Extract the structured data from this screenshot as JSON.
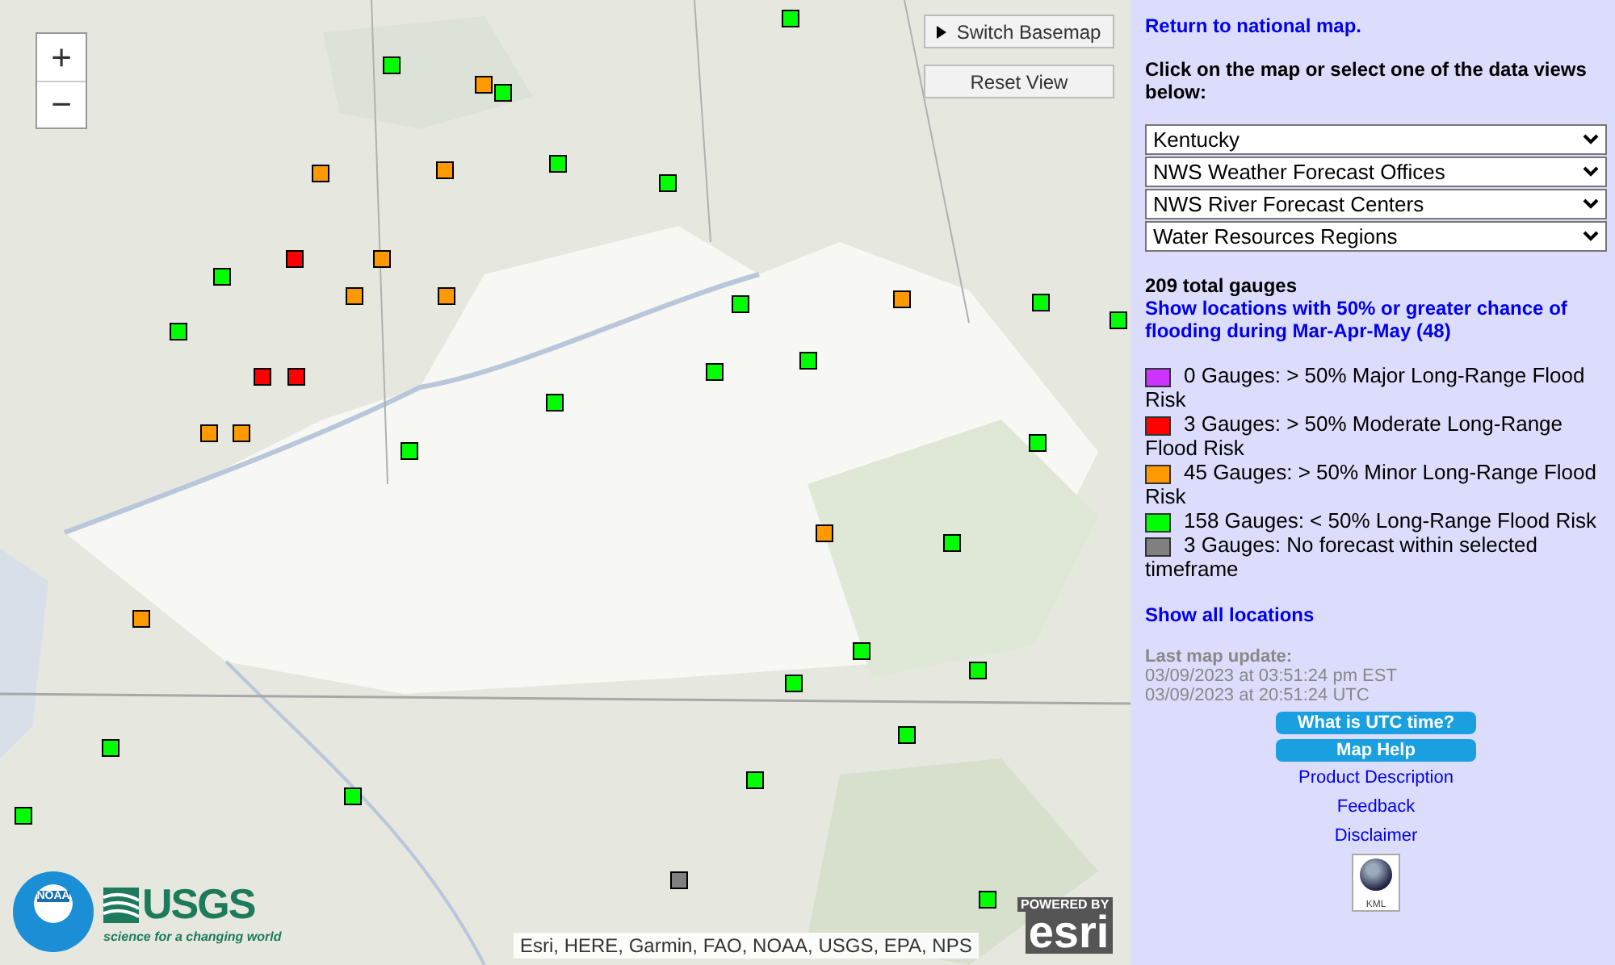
{
  "map": {
    "zoom_in": "+",
    "zoom_out": "−",
    "switch_basemap": "Switch Basemap",
    "reset_view": "Reset View",
    "attribution": "Esri, HERE, Garmin, FAO, NOAA, USGS, EPA, NPS",
    "noaa_logo": "NOAA",
    "usgs_logo": {
      "name": "USGS",
      "tagline": "science for a changing world"
    },
    "esri_logo": {
      "powered": "POWERED BY",
      "name": "esri"
    },
    "markers": [
      {
        "color": "#00ff00"
      },
      {
        "color": "#00ff00"
      },
      {
        "color": "#ff9900"
      },
      {
        "color": "#00ff00"
      },
      {
        "color": "#ff9900"
      },
      {
        "color": "#ff9900"
      },
      {
        "color": "#00ff00"
      },
      {
        "color": "#00ff00"
      },
      {
        "color": "#ff0000"
      },
      {
        "color": "#ff9900"
      },
      {
        "color": "#ff9900"
      },
      {
        "color": "#ff9900"
      },
      {
        "color": "#00ff00"
      },
      {
        "color": "#00ff00"
      },
      {
        "color": "#ff0000"
      },
      {
        "color": "#ff0000"
      },
      {
        "color": "#ff9900"
      },
      {
        "color": "#ff9900"
      },
      {
        "color": "#00ff00"
      },
      {
        "color": "#00ff00"
      },
      {
        "color": "#00ff00"
      },
      {
        "color": "#00ff00"
      },
      {
        "color": "#00ff00"
      },
      {
        "color": "#ff9900"
      },
      {
        "color": "#00ff00"
      },
      {
        "color": "#00ff00"
      },
      {
        "color": "#00ff00"
      },
      {
        "color": "#00ff00"
      },
      {
        "color": "#ff9900"
      },
      {
        "color": "#00ff00"
      },
      {
        "color": "#00ff00"
      },
      {
        "color": "#00ff00"
      },
      {
        "color": "#00ff00"
      },
      {
        "color": "#00ff00"
      },
      {
        "color": "#808080"
      },
      {
        "color": "#00ff00"
      },
      {
        "color": "#00ff00"
      },
      {
        "color": "#00ff00"
      },
      {
        "color": "#ff9900"
      },
      {
        "color": "#00ff00"
      }
    ]
  },
  "sidebar": {
    "return_link": "Return to national map.",
    "instruction": "Click on the map or select one of the data views below:",
    "selects": [
      "Kentucky",
      "NWS Weather Forecast Offices",
      "NWS River Forecast Centers",
      "Water Resources Regions"
    ],
    "total": "209 total gauges",
    "filter_link": "Show locations with 50% or greater chance of flooding during Mar-Apr-May (48)",
    "legend": [
      {
        "color": "#cc33ff",
        "label": "0 Gauges: > 50% Major Long-Range Flood Risk"
      },
      {
        "color": "#ff0000",
        "label": "3 Gauges: > 50% Moderate Long-Range Flood Risk"
      },
      {
        "color": "#ff9900",
        "label": "45 Gauges: > 50% Minor Long-Range Flood Risk"
      },
      {
        "color": "#00ff00",
        "label": "158 Gauges: < 50% Long-Range Flood Risk"
      },
      {
        "color": "#808080",
        "label": "3 Gauges: No forecast within selected timeframe"
      }
    ],
    "show_all": "Show all locations",
    "update_label": "Last map update:",
    "update_est": "03/09/2023 at 03:51:24 pm EST",
    "update_utc": "03/09/2023 at 20:51:24 UTC",
    "buttons": [
      "What is UTC time?",
      "Map Help"
    ],
    "links": [
      "Product Description",
      "Feedback",
      "Disclaimer"
    ],
    "kml": "KML"
  }
}
